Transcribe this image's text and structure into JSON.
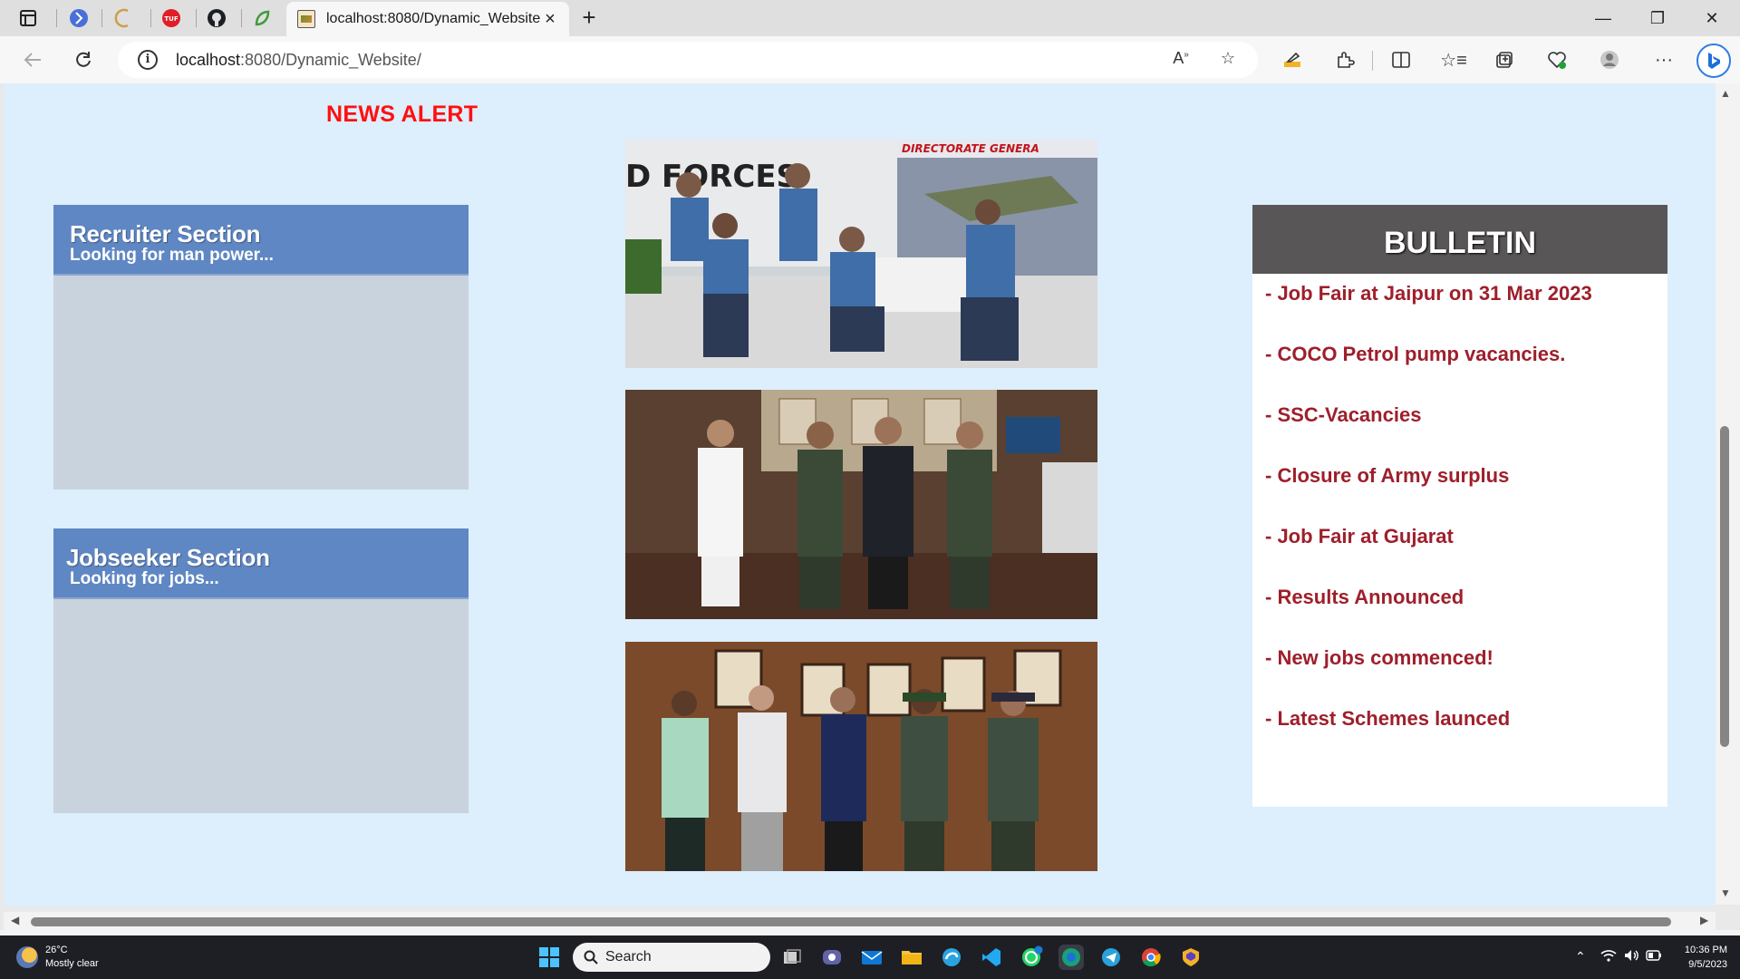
{
  "browser": {
    "tab_title": "localhost:8080/Dynamic_Website/",
    "tab_close": "×",
    "new_tab": "+",
    "url_host": "localhost",
    "url_path": ":8080/Dynamic_Website/",
    "window_controls": {
      "minimize": "—",
      "restore": "❐",
      "close": "✕"
    }
  },
  "page": {
    "news_alert": "NEWS ALERT",
    "recruiter": {
      "title": "Recruiter Section",
      "subtitle": "Looking for man power..."
    },
    "jobseeker": {
      "title": "Jobseeker Section",
      "subtitle": "Looking for jobs..."
    },
    "photos": [
      "photo-aero-india-officers",
      "photo-officers-office-meeting",
      "photo-officers-group-portraits"
    ],
    "bulletin": {
      "title": "BULLETIN",
      "items": [
        "- Job Fair at Jaipur on 31 Mar 2023",
        "- COCO Petrol pump vacancies.",
        "- SSC-Vacancies",
        "- Closure of Army surplus",
        "- Job Fair at Gujarat",
        "- Results Announced",
        "- New jobs commenced!",
        "- Latest Schemes launced"
      ]
    }
  },
  "taskbar": {
    "weather_temp": "26°C",
    "weather_desc": "Mostly clear",
    "search_placeholder": "Search",
    "time": "10:36 PM",
    "date": "9/5/2023"
  },
  "colors": {
    "page_bg": "#ddeefc",
    "news_alert": "#ff1010",
    "section_header": "#5f87c3",
    "section_body": "#c9d3dd",
    "bulletin_header": "#595657",
    "bulletin_text": "#9e1f2b"
  }
}
